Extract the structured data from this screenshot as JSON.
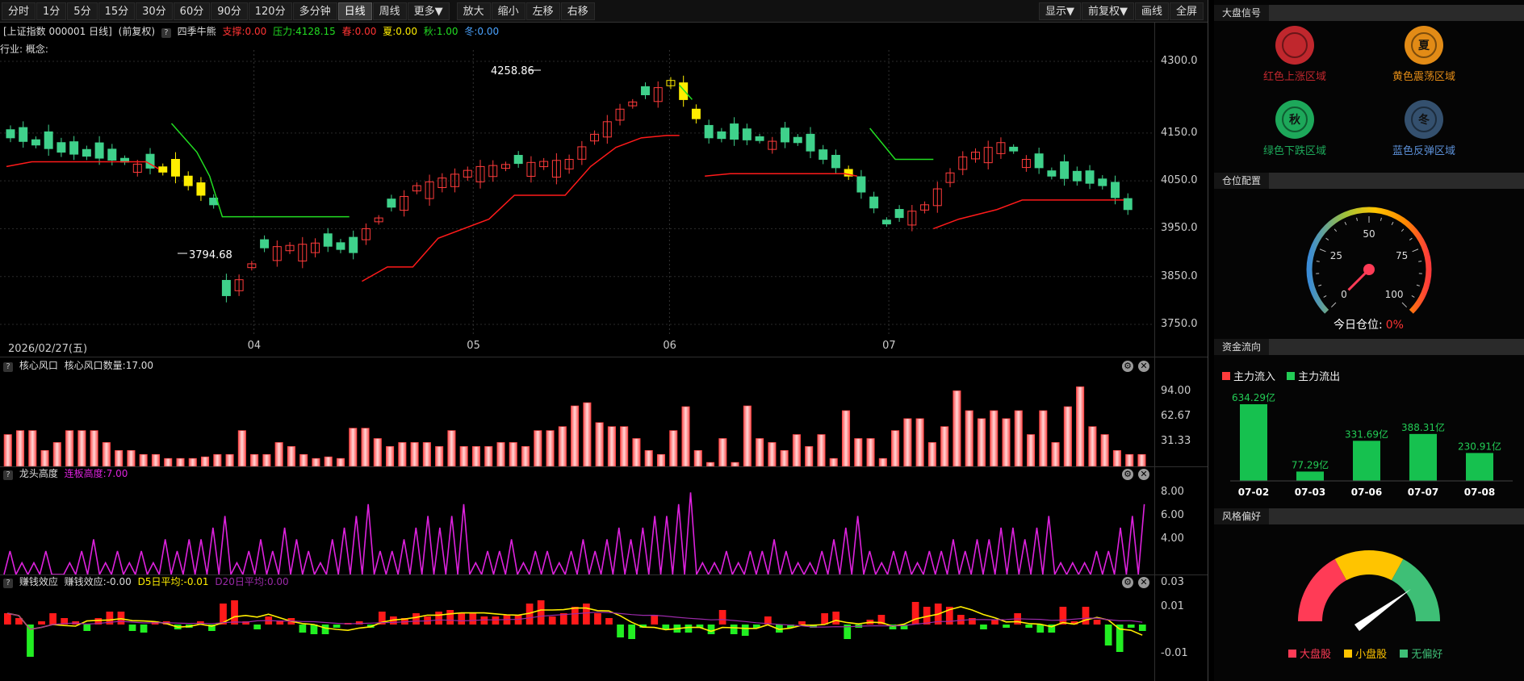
{
  "toolbar": {
    "periods": [
      "分时",
      "1分",
      "5分",
      "15分",
      "30分",
      "60分",
      "90分",
      "120分",
      "多分钟",
      "日线",
      "周线",
      "更多▼"
    ],
    "active": "日线",
    "actions": [
      "放大",
      "缩小",
      "左移",
      "右移"
    ],
    "right": [
      "显示▼",
      "前复权▼",
      "画线",
      "全屏"
    ]
  },
  "info": {
    "index": "[上证指数 000001 日线]",
    "adjust": "(前复权)",
    "indicator": "四季牛熊",
    "support": "支撑:0.00",
    "pressure": "压力:4128.15",
    "spring": "春:0.00",
    "summer": "夏:0.00",
    "autumn": "秋:1.00",
    "winter": "冬:0.00",
    "industry": "行业: 概念:"
  },
  "main_chart": {
    "price_ticks": [
      "4300.0",
      "4150.0",
      "4050.0",
      "3950.0",
      "3850.0",
      "3750.0"
    ],
    "high_label": "4258.86",
    "low_label": "3794.68",
    "date_label": "2026/02/27(五)",
    "months": [
      "04",
      "05",
      "06",
      "07"
    ]
  },
  "panel1": {
    "name": "核心风口",
    "value": "核心风口数量:17.00",
    "ticks": [
      "94.00",
      "62.67",
      "31.33"
    ]
  },
  "panel2": {
    "name": "龙头高度",
    "value": "连板高度:7.00",
    "ticks": [
      "8.00",
      "6.00",
      "4.00"
    ]
  },
  "panel3": {
    "name": "赚钱效应",
    "value": "赚钱效应:-0.00",
    "d5": "D5日平均:-0.01",
    "d20": "D20日平均:0.00",
    "ticks": [
      "0.03",
      "0.01",
      "-0.01"
    ]
  },
  "colors": {
    "up": "#ff3b3b",
    "down": "#3fd18b",
    "support": "#ff1a1a",
    "pressure": "#22dd22",
    "magenta": "#dd22dd",
    "yellow": "#ffee00"
  },
  "right_panel": {
    "signal_title": "大盘信号",
    "signals": [
      {
        "glyph": "",
        "label": "红色上涨区域",
        "color": "#c0272d"
      },
      {
        "glyph": "夏",
        "label": "黄色震荡区域",
        "color": "#e28b16"
      },
      {
        "glyph": "秋",
        "label": "绿色下跌区域",
        "color": "#1da85a"
      },
      {
        "glyph": "冬",
        "label": "蓝色反弹区域",
        "color": "#34506e"
      }
    ],
    "position_title": "仓位配置",
    "gauge_ticks": [
      "0",
      "25",
      "50",
      "75",
      "100"
    ],
    "position_label": "今日仓位:",
    "position_value": "0%",
    "position_level": 0,
    "flow_title": "资金流向",
    "flow_legend": [
      "主力流入",
      "主力流出"
    ],
    "flows": [
      {
        "date": "07-02",
        "label": "634.29亿",
        "value": 634.29
      },
      {
        "date": "07-03",
        "label": "77.29亿",
        "value": 77.29
      },
      {
        "date": "07-06",
        "label": "331.69亿",
        "value": 331.69
      },
      {
        "date": "07-07",
        "label": "388.31亿",
        "value": 388.31
      },
      {
        "date": "07-08",
        "label": "230.91亿",
        "value": 230.91
      }
    ],
    "style_title": "风格偏好",
    "style_legend": [
      "大盘股",
      "小盘股",
      "无偏好"
    ]
  }
}
